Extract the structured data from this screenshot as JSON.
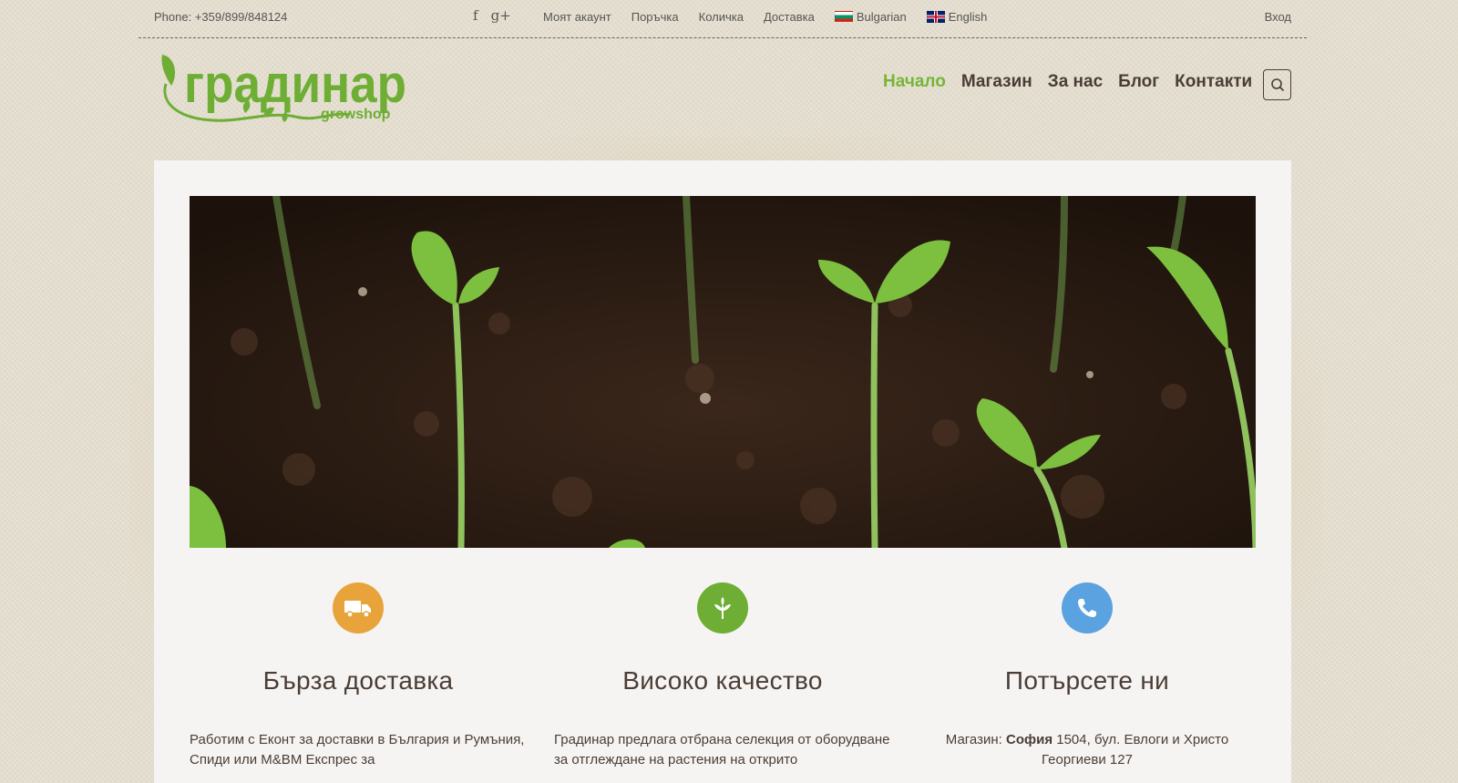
{
  "topbar": {
    "phone": "Phone: +359/899/848124",
    "social": [
      "f",
      "g+"
    ],
    "links": [
      "Моят акаунт",
      "Поръчка",
      "Количка",
      "Доставка"
    ],
    "lang_bg": "Bulgarian",
    "lang_en": "English",
    "login": "Вход"
  },
  "logo": {
    "title": "градинар",
    "subtitle": "growshop"
  },
  "nav": {
    "items": [
      "Начало",
      "Магазин",
      "За нас",
      "Блог",
      "Контакти"
    ],
    "active_index": 0
  },
  "features": [
    {
      "icon": "truck-icon",
      "color": "#e8a43a",
      "title": "Бърза доставка",
      "text": "Работим с Еконт за доставки в България и Румъния, Спиди или М&ВМ Експрес за"
    },
    {
      "icon": "leaf-icon",
      "color": "#6eae35",
      "title": "Високо качество",
      "text": "Градинар предлага отбрана селекция от оборудване за отглеждане на растения на открито"
    },
    {
      "icon": "phone-icon",
      "color": "#5aa3e0",
      "title": "Потърсете ни",
      "text_prefix": "Магазин: ",
      "text_bold": "София",
      "text_suffix": " 1504, бул. Евлоги и Христо Георгиеви 127"
    }
  ],
  "colors": {
    "accent": "#76b539",
    "text": "#4a3d36",
    "background": "#e7e0d1"
  }
}
